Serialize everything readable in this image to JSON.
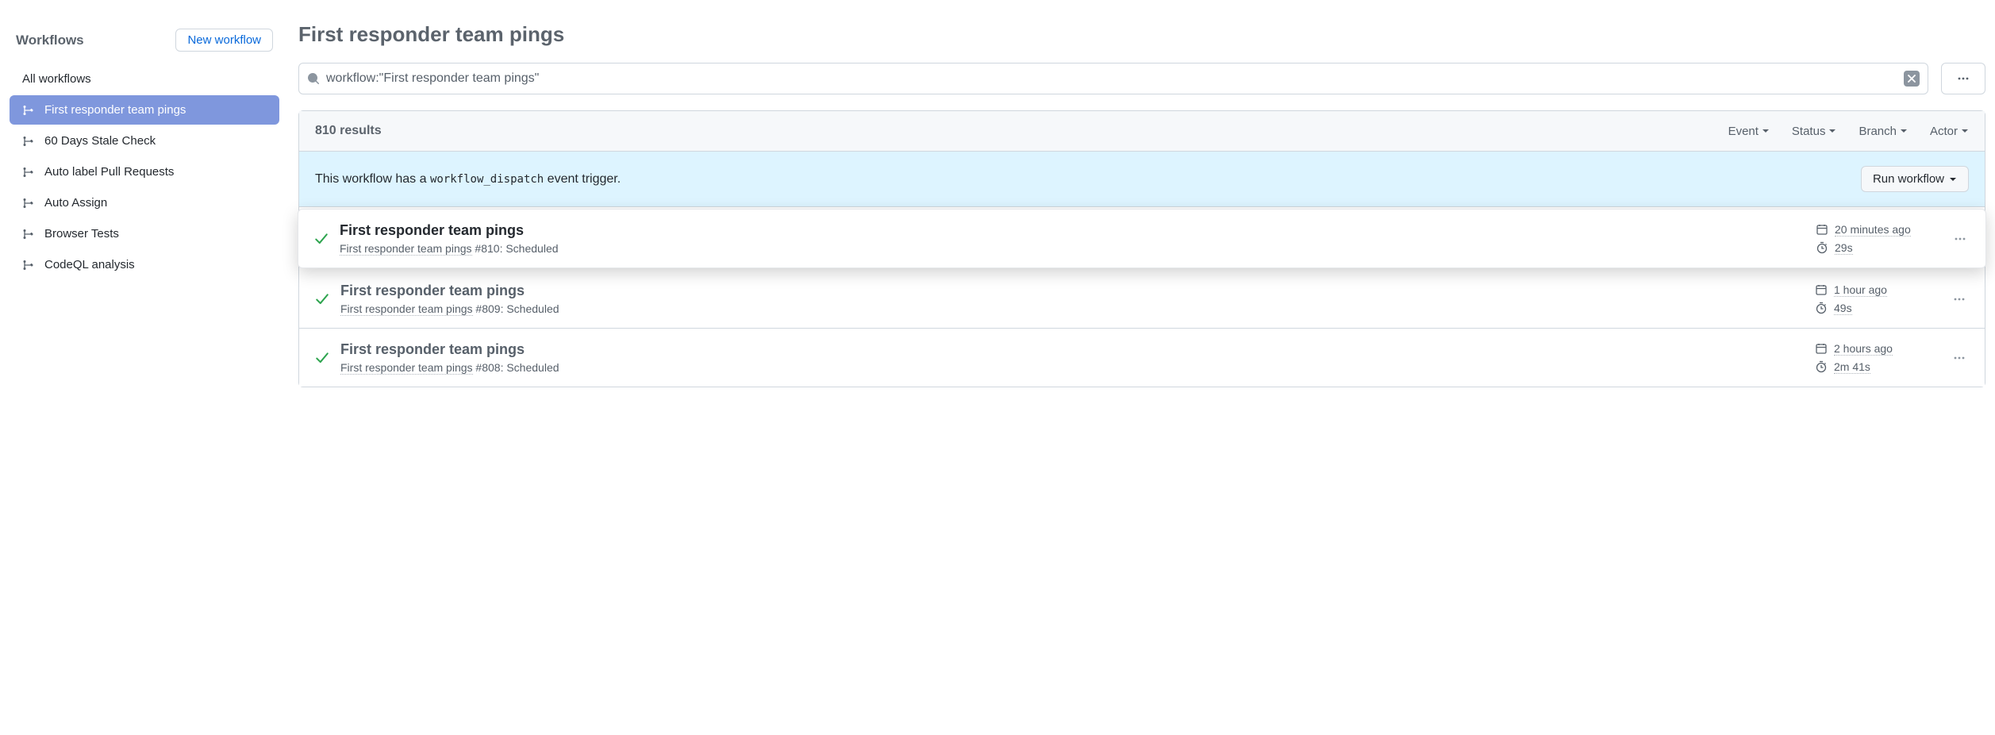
{
  "sidebar": {
    "title": "Workflows",
    "new_button": "New workflow",
    "all_label": "All workflows",
    "items": [
      {
        "label": "First responder team pings",
        "active": true
      },
      {
        "label": "60 Days Stale Check",
        "active": false
      },
      {
        "label": "Auto label Pull Requests",
        "active": false
      },
      {
        "label": "Auto Assign",
        "active": false
      },
      {
        "label": "Browser Tests",
        "active": false
      },
      {
        "label": "CodeQL analysis",
        "active": false
      }
    ]
  },
  "page_title": "First responder team pings",
  "search": {
    "value": "workflow:\"First responder team pings\""
  },
  "results": {
    "count_label": "810 results"
  },
  "filters": {
    "event": "Event",
    "status": "Status",
    "branch": "Branch",
    "actor": "Actor"
  },
  "dispatch": {
    "prefix": "This workflow has a ",
    "code": "workflow_dispatch",
    "suffix": " event trigger.",
    "button": "Run workflow"
  },
  "runs": [
    {
      "title": "First responder team pings",
      "wf": "First responder team pings",
      "num": "#810",
      "trigger": "Scheduled",
      "time": "20 minutes ago",
      "duration": "29s",
      "highlight": true
    },
    {
      "title": "First responder team pings",
      "wf": "First responder team pings",
      "num": "#809",
      "trigger": "Scheduled",
      "time": "1 hour ago",
      "duration": "49s",
      "highlight": false
    },
    {
      "title": "First responder team pings",
      "wf": "First responder team pings",
      "num": "#808",
      "trigger": "Scheduled",
      "time": "2 hours ago",
      "duration": "2m 41s",
      "highlight": false
    }
  ]
}
